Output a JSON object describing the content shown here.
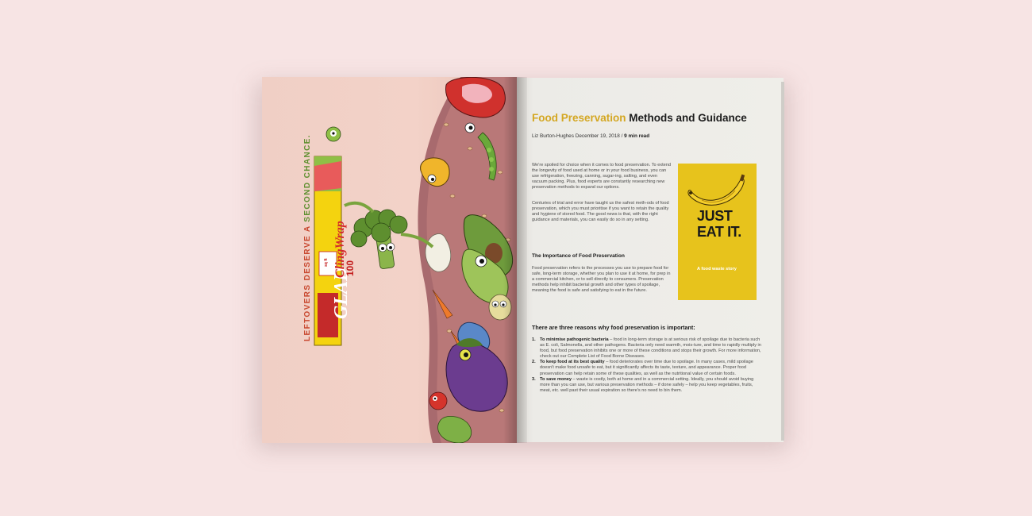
{
  "spread": {
    "ad": {
      "tagline_part1": "LEFTOVERS DESERVE A ",
      "tagline_part2": "SECOND CHANCE.",
      "brand": "GLAD",
      "product": "ClingWrap",
      "count": "100",
      "count_unit": "sq ft",
      "colors": {
        "tagline_red": "#c8472e",
        "tagline_green": "#5e8f2f",
        "box_yellow": "#f4d30f",
        "box_red": "#d42a2a"
      }
    },
    "article": {
      "title_accent": "Food Preservation",
      "title_rest": " Methods and Guidance",
      "byline_author_date": "Liz Burton-Hughes December 19, 2018 / ",
      "byline_readtime": "9 min read",
      "intro": "We're spoiled for choice when it comes to food preservation. To extend the longevity of food used at home or in your food business, you can use refrigeration, freezing, canning, sugar-ing, salting, and even vacuum packing. Plus, food experts are constantly researching new preservation methods to expand our options.",
      "para2": "Centuries of trial and error have taught us the safest meth-ods of food preservation, which you must prioritise if you want to retain the quality and hygiene of stored food. The good news is that, with the right guidance and materials, you can easily do so in any setting.",
      "importance_heading": "The Importance of Food Preservation",
      "importance_body": "Food preservation refers to the processes you use to prepare food for safe, long-term storage, whether you plan to use it at home, for prep in a commercial kitchen, or to sell directly to consumers. Preservation methods help inhibit bacterial growth and other types of spoilage, meaning the food is safe and satisfying to eat in the future.",
      "reasons_heading": "There are three reasons why food preservation is important:",
      "reasons": [
        {
          "num": "1.",
          "lead": "To minimise pathogenic bacteria",
          "text": " – food in long-term storage is at serious risk of spoilage due to bacteria such as E. coli, Salmonella, and other pathogens. Bacteria only need warmth, mois-ture, and time to rapidly multiply in food, but food preservation inhibits one or more of these conditions and stops their growth. For more information, check out our Complete List of Food Borne Diseases."
        },
        {
          "num": "2.",
          "lead": "To keep food at its best quality",
          "text": " – food deteriorates over time due to spoilage. In many cases, mild spoilage doesn't make food unsafe to eat, but it significantly affects its taste, texture, and appearance. Proper food preservation can help retain some of these qualities, as well as the nutritional value of certain foods."
        },
        {
          "num": "3.",
          "lead": "To save money",
          "text": " – waste is costly, both at home and in a commercial setting. Ideally, you should avoid buying more than you can use, but various preservation methods – if done safely – help you keep vegetables, fruits, meat, etc. well past their usual expiration so there's no need to bin them."
        }
      ],
      "poster": {
        "title": "JUST EAT IT.",
        "subtitle": "A food waste story",
        "color": "#e7c31c"
      },
      "colors": {
        "accent": "#d4a722"
      }
    }
  }
}
